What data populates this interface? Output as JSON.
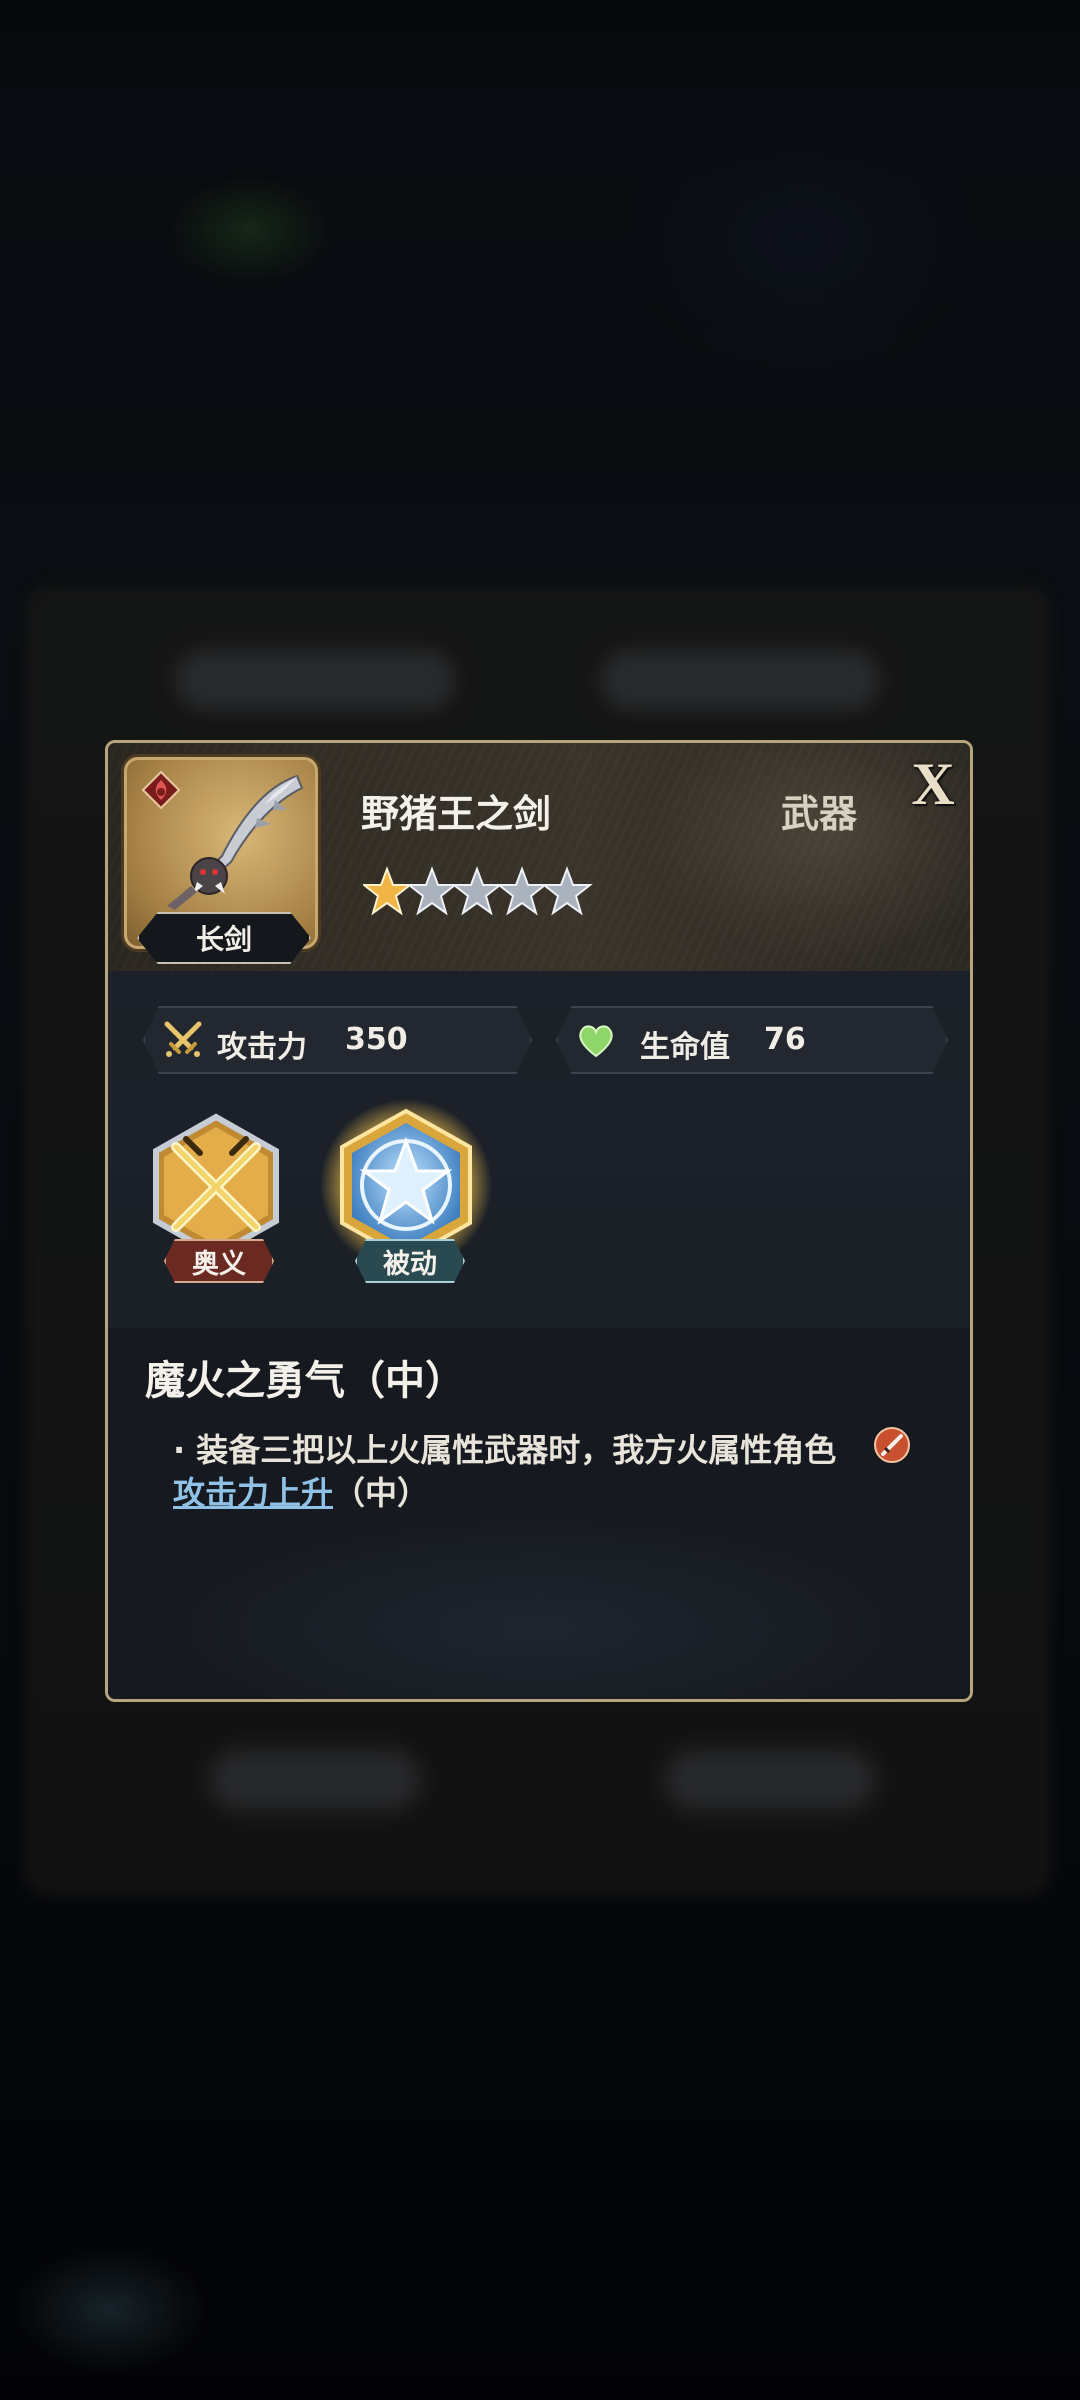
{
  "dialog": {
    "weapon_name": "野猪王之剑",
    "category": "武器",
    "weapon_type": "长剑",
    "rarity_stars_filled": 1,
    "rarity_stars_total": 5,
    "close_label": "X",
    "element_icon": "fire-element-icon"
  },
  "stats": [
    {
      "label": "攻击力",
      "value": "350",
      "icon": "crossed-swords-icon"
    },
    {
      "label": "生命值",
      "value": "76",
      "icon": "heart-icon"
    }
  ],
  "skills": [
    {
      "tag": "奥义",
      "icon": "crossed-blades-skill-icon",
      "selected": false
    },
    {
      "tag": "被动",
      "icon": "star-passive-skill-icon",
      "selected": true
    }
  ],
  "skill_detail": {
    "name": "魔火之勇气（中）",
    "line1": "· 装备三把以上火属性武器时，我方火属性角色",
    "link_text": "攻击力上升",
    "line2_rest": "（中）"
  },
  "colors": {
    "frame_gold": "#b7a57e",
    "link_blue": "#8fc2e6",
    "passive_glow": "#f2c24d",
    "heart_green": "#8fd66a"
  }
}
